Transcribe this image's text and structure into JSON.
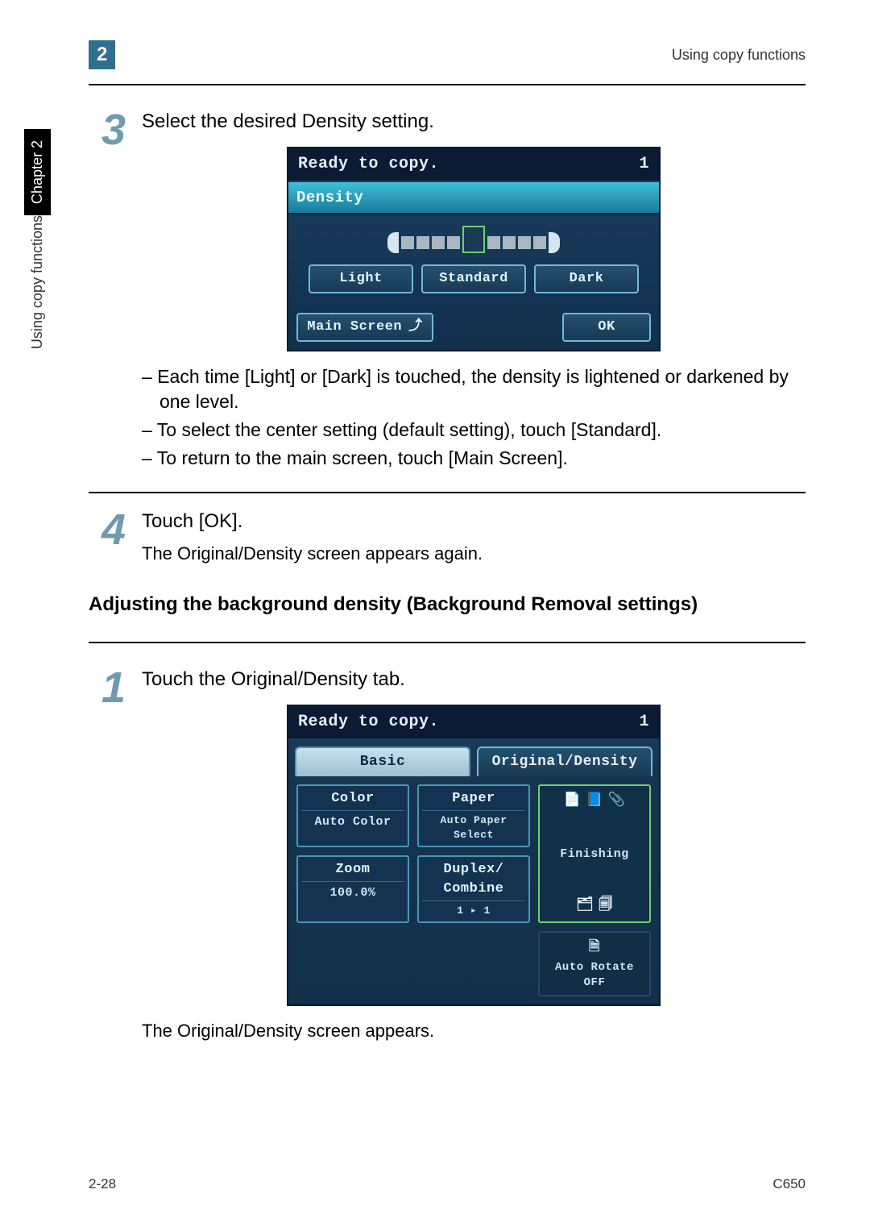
{
  "header": {
    "chapter_num": "2",
    "title": "Using copy functions"
  },
  "sidetab": {
    "chapter": "Chapter 2",
    "section": "Using copy functions"
  },
  "step3": {
    "num": "3",
    "instruction": "Select the desired Density setting.",
    "bullets": [
      "Each time [Light] or [Dark] is touched, the density is lightened or darkened by one level.",
      "To select the center setting (default setting), touch [Standard].",
      "To return to the main screen, touch [Main Screen]."
    ],
    "lcd": {
      "status": "Ready to copy.",
      "count": "1",
      "title": "Density",
      "light": "Light",
      "standard": "Standard",
      "dark": "Dark",
      "main": "Main Screen",
      "ok": "OK"
    }
  },
  "step4": {
    "num": "4",
    "instruction": "Touch [OK].",
    "sub": "The Original/Density screen appears again."
  },
  "section_heading": "Adjusting the background density (Background Removal settings)",
  "step1": {
    "num": "1",
    "instruction": "Touch the Original/Density tab.",
    "after": "The Original/Density screen appears.",
    "lcd": {
      "status": "Ready to copy.",
      "count": "1",
      "tab_basic": "Basic",
      "tab_od": "Original/Density",
      "color_hd": "Color",
      "color_vl": "Auto Color",
      "paper_hd": "Paper",
      "paper_vl": "Auto Paper Select",
      "zoom_hd": "Zoom",
      "zoom_vl": "100.0%",
      "dup_hd": "Duplex/ Combine",
      "dup_vl": "1 ▸ 1",
      "finishing": "Finishing",
      "autorotate": "Auto Rotate OFF"
    }
  },
  "footer": {
    "page": "2-28",
    "model": "C650"
  }
}
